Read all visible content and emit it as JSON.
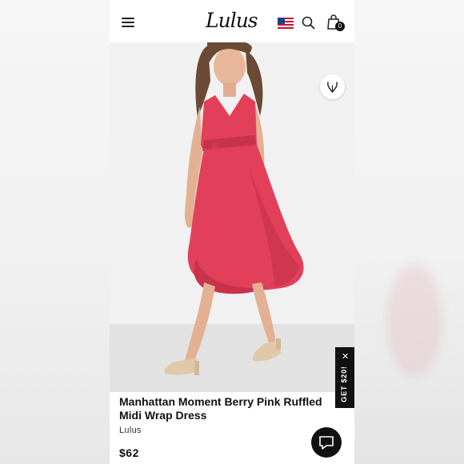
{
  "header": {
    "logo_text": "Lulus",
    "icons": [
      "hamburger-menu-icon",
      "us-flag-icon",
      "search-icon",
      "shopping-bag-icon"
    ],
    "bag_count": "0"
  },
  "gallery": {
    "image_count": 4,
    "active_index": 0,
    "dress_color": "#e2405a"
  },
  "promo": {
    "label": "GET $20!",
    "close_label": "✕"
  },
  "product": {
    "title": "Manhattan Moment Berry Pink Ruffled Midi Wrap Dress",
    "brand": "Lulus",
    "price": "$62"
  },
  "colors": {
    "accent_black": "#111111",
    "background": "#ffffff"
  }
}
